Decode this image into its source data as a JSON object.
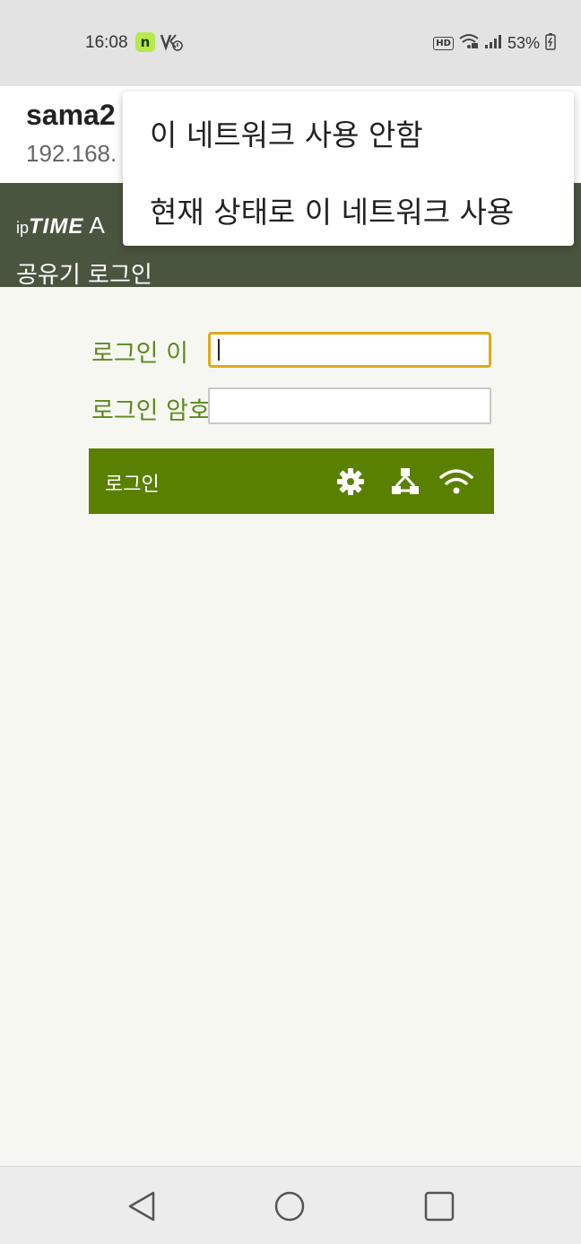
{
  "status_bar": {
    "time": "16:08",
    "app_badge": "n",
    "hd_label": "HD",
    "battery_percent": "53%"
  },
  "network": {
    "name_partial": "sama2",
    "ip_partial": "192.168."
  },
  "page": {
    "logo_prefix": "ip",
    "logo_brand": "TIME",
    "logo_rest": "A",
    "subtitle": "공유기 로그인"
  },
  "popup_menu": {
    "items": [
      "이 네트워크 사용 안함",
      "현재 상태로 이 네트워크 사용"
    ]
  },
  "login_form": {
    "id_label": "로그인 이",
    "pw_label": "로그인 암호",
    "login_button_label": "로그인"
  },
  "colors": {
    "header_bg": "#4a5540",
    "login_bar": "#5a8000",
    "label_green": "#5a8a1e",
    "focus_border": "#e0a81a"
  }
}
